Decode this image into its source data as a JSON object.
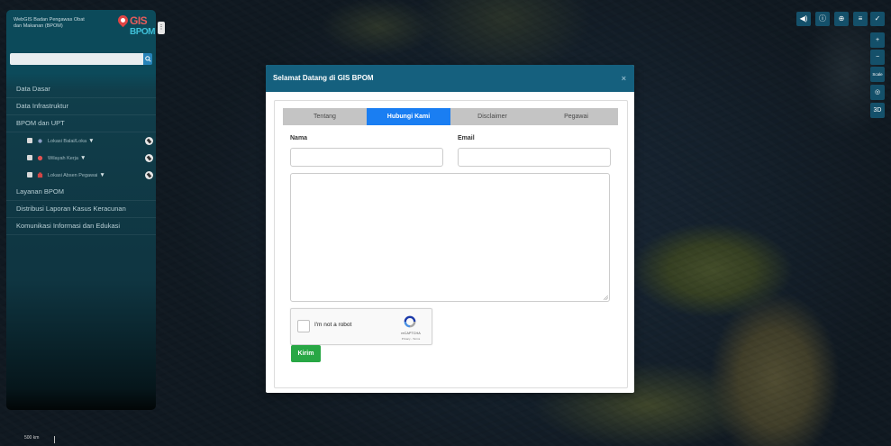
{
  "sidebar": {
    "brand_text": "WebGIS Badan Pengawas Obat dan Makanan (BPOM)",
    "logo_gis": "GIS",
    "logo_bpom": "BPOM",
    "search": {
      "placeholder": ""
    },
    "menu": [
      {
        "label": "Data Dasar"
      },
      {
        "label": "Data Infrastruktur"
      },
      {
        "label": "BPOM dan UPT"
      },
      {
        "label": "Layanan BPOM"
      },
      {
        "label": "Distribusi Laporan Kasus Keracunan"
      },
      {
        "label": "Komunikasi Informasi dan Edukasi"
      }
    ],
    "layers": [
      {
        "label": "Lokasi Balai/Loka",
        "symbol_color": "#8a9ec4"
      },
      {
        "label": "Wilayah Kerja",
        "symbol_color": "#e05252"
      },
      {
        "label": "Lokasi Absen Pegawai",
        "symbol_color": "#d24545"
      }
    ]
  },
  "toolbar": {
    "top": [
      "◀)",
      "ⓘ",
      "⊕",
      "≡",
      "✓"
    ],
    "right": [
      "+",
      "−",
      "Scale",
      "◎",
      "3D"
    ]
  },
  "map": {
    "scale_label": "500 km"
  },
  "modal": {
    "title": "Selamat Datang di GIS BPOM",
    "close": "×",
    "tabs": [
      {
        "label": "Tentang",
        "active": false
      },
      {
        "label": "Hubungi Kami",
        "active": true
      },
      {
        "label": "Disclaimer",
        "active": false
      },
      {
        "label": "Pegawai",
        "active": false
      }
    ],
    "form": {
      "name_label": "Nama",
      "email_label": "Email",
      "name_value": "",
      "email_value": "",
      "message_value": "",
      "captcha_text": "I'm not a robot",
      "captcha_brand": "reCAPTCHA",
      "captcha_terms": "Privacy - Terms",
      "submit_label": "Kirim"
    }
  },
  "colors": {
    "header": "#15607e",
    "tab_active": "#1a7ef2",
    "submit": "#28a745"
  }
}
